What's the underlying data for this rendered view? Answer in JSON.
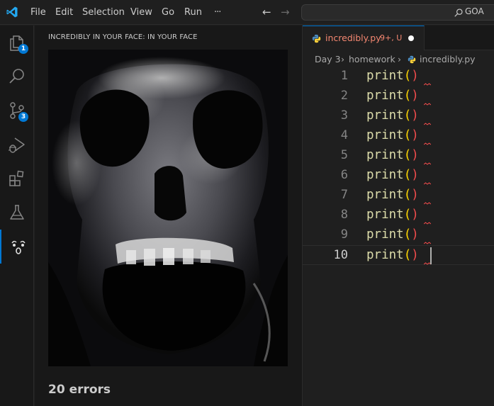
{
  "titlebar": {
    "menu": [
      "File",
      "Edit",
      "Selection",
      "View",
      "Go",
      "Run",
      "···"
    ],
    "back_icon": "arrow-left-icon",
    "forward_icon": "arrow-right-icon",
    "command_center_text": "GOA"
  },
  "activity_bar": {
    "items": [
      {
        "name": "explorer",
        "icon": "files-icon",
        "badge": "1"
      },
      {
        "name": "search",
        "icon": "search-icon",
        "badge": ""
      },
      {
        "name": "source-control",
        "icon": "source-control-icon",
        "badge": "3"
      },
      {
        "name": "run-debug",
        "icon": "run-debug-icon",
        "badge": ""
      },
      {
        "name": "extensions",
        "icon": "extensions-icon",
        "badge": ""
      },
      {
        "name": "testing",
        "icon": "flask-icon",
        "badge": ""
      },
      {
        "name": "screaming-face",
        "icon": "screaming-face-icon",
        "badge": "",
        "active": true
      }
    ],
    "accent": "#0078d4"
  },
  "side_panel": {
    "title": "INCREDIBLY IN YOUR FACE: IN YOUR FACE",
    "image": "screaming-skull-image",
    "status": "20 errors"
  },
  "editor": {
    "tab": {
      "filename": "incredibly.py",
      "status": "9+, U",
      "icon": "python-icon",
      "color": "#f48771"
    },
    "breadcrumb": [
      "Day 3",
      "homework",
      "incredibly.py"
    ],
    "lines": [
      {
        "n": "1",
        "fn": "print",
        "open": "(",
        "close": ")"
      },
      {
        "n": "2",
        "fn": "print",
        "open": "(",
        "close": ")"
      },
      {
        "n": "3",
        "fn": "print",
        "open": "(",
        "close": ")"
      },
      {
        "n": "4",
        "fn": "print",
        "open": "(",
        "close": ")"
      },
      {
        "n": "5",
        "fn": "print",
        "open": "(",
        "close": ")"
      },
      {
        "n": "6",
        "fn": "print",
        "open": "(",
        "close": ")"
      },
      {
        "n": "7",
        "fn": "print",
        "open": "(",
        "close": ")"
      },
      {
        "n": "8",
        "fn": "print",
        "open": "(",
        "close": ")"
      },
      {
        "n": "9",
        "fn": "print",
        "open": "(",
        "close": ")"
      },
      {
        "n": "10",
        "fn": "print",
        "open": "(",
        "close": ")"
      }
    ],
    "current_line": "10",
    "colors": {
      "function": "#dcdcaa",
      "paren": "#ffd700",
      "error": "#f14c4c"
    }
  }
}
